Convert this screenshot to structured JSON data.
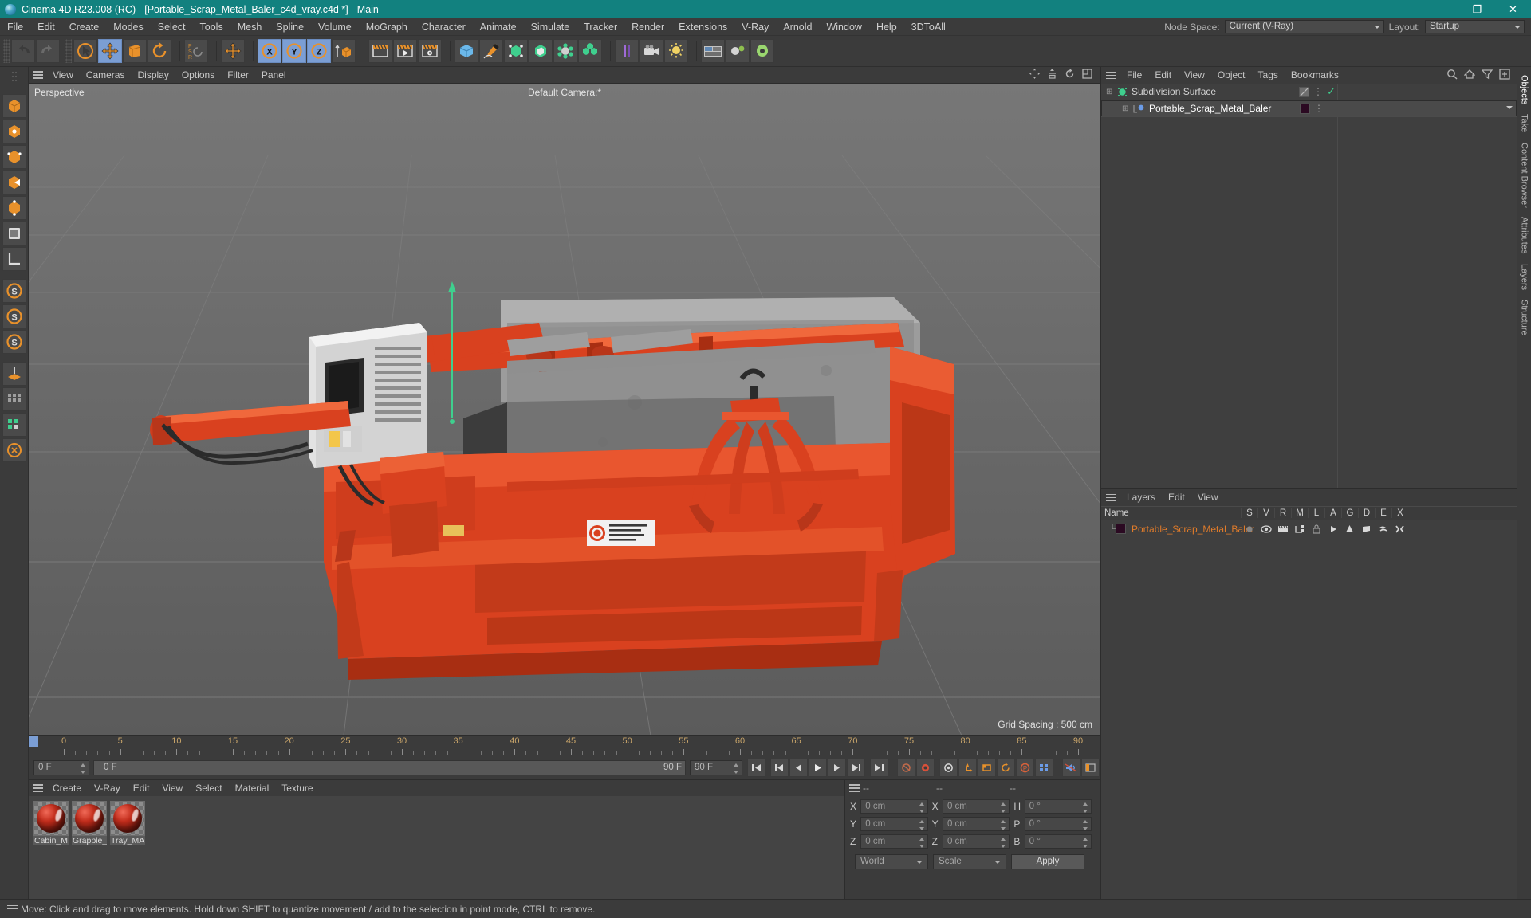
{
  "titlebar": {
    "text": "Cinema 4D R23.008 (RC) - [Portable_Scrap_Metal_Baler_c4d_vray.c4d *] - Main",
    "minimize": "–",
    "maximize": "❐",
    "close": "✕"
  },
  "menubar": {
    "items": [
      "File",
      "Edit",
      "Create",
      "Modes",
      "Select",
      "Tools",
      "Mesh",
      "Spline",
      "Volume",
      "MoGraph",
      "Character",
      "Animate",
      "Simulate",
      "Tracker",
      "Render",
      "Extensions",
      "V-Ray",
      "Arnold",
      "Window",
      "Help",
      "3DToAll"
    ],
    "node_space_label": "Node Space:",
    "node_space_value": "Current (V-Ray)",
    "layout_label": "Layout:",
    "layout_value": "Startup"
  },
  "viewport": {
    "menu": [
      "View",
      "Cameras",
      "Display",
      "Options",
      "Filter",
      "Panel"
    ],
    "view_label": "Perspective",
    "camera_label": "Default Camera:*",
    "grid_spacing": "Grid Spacing : 500 cm",
    "axis_x": "X",
    "axis_y": "Y",
    "axis_z": "Z"
  },
  "timeline": {
    "ticks": [
      "0",
      "5",
      "10",
      "15",
      "20",
      "25",
      "30",
      "35",
      "40",
      "45",
      "50",
      "55",
      "60",
      "65",
      "70",
      "75",
      "80",
      "85",
      "90"
    ],
    "current_frame": "0 F",
    "start_frame": "0 F",
    "end_frame": "90 F",
    "max_frame": "90 F",
    "field_right": "0 F"
  },
  "material_manager": {
    "menu": [
      "Create",
      "V-Ray",
      "Edit",
      "View",
      "Select",
      "Material",
      "Texture"
    ],
    "materials": [
      {
        "name": "Cabin_M"
      },
      {
        "name": "Grapple_"
      },
      {
        "name": "Tray_MA"
      }
    ]
  },
  "coordinates": {
    "header": [
      "--",
      "--",
      "--"
    ],
    "position": [
      {
        "axis": "X",
        "value": "0 cm"
      },
      {
        "axis": "Y",
        "value": "0 cm"
      },
      {
        "axis": "Z",
        "value": "0 cm"
      }
    ],
    "size": [
      {
        "axis": "X",
        "value": "0 cm"
      },
      {
        "axis": "Y",
        "value": "0 cm"
      },
      {
        "axis": "Z",
        "value": "0 cm"
      }
    ],
    "rotation": [
      {
        "axis": "H",
        "value": "0 °"
      },
      {
        "axis": "P",
        "value": "0 °"
      },
      {
        "axis": "B",
        "value": "0 °"
      }
    ],
    "space_value": "World",
    "mode_value": "Scale",
    "apply_label": "Apply"
  },
  "object_manager": {
    "menu": [
      "File",
      "Edit",
      "View",
      "Object",
      "Tags",
      "Bookmarks"
    ],
    "rows": [
      {
        "name": "Subdivision Surface",
        "indent": 0
      },
      {
        "name": "Portable_Scrap_Metal_Baler",
        "indent": 1
      }
    ]
  },
  "layer_manager": {
    "menu": [
      "Layers",
      "Edit",
      "View"
    ],
    "name_column": "Name",
    "columns": [
      "S",
      "V",
      "R",
      "M",
      "L",
      "A",
      "G",
      "D",
      "E",
      "X"
    ],
    "rows": [
      {
        "name": "Portable_Scrap_Metal_Baler"
      }
    ]
  },
  "right_tabs": [
    "Objects",
    "Take",
    "Content Browser",
    "Attributes",
    "Layers",
    "Structure"
  ],
  "statusbar": {
    "text": "Move: Click and drag to move elements. Hold down SHIFT to quantize movement / add to the selection in point mode, CTRL to remove."
  },
  "colors": {
    "title_bar": "#12817f",
    "accent_blue": "#7b9ed4",
    "layer_orange": "#e07b2a",
    "model_orange": "#d9411f"
  }
}
